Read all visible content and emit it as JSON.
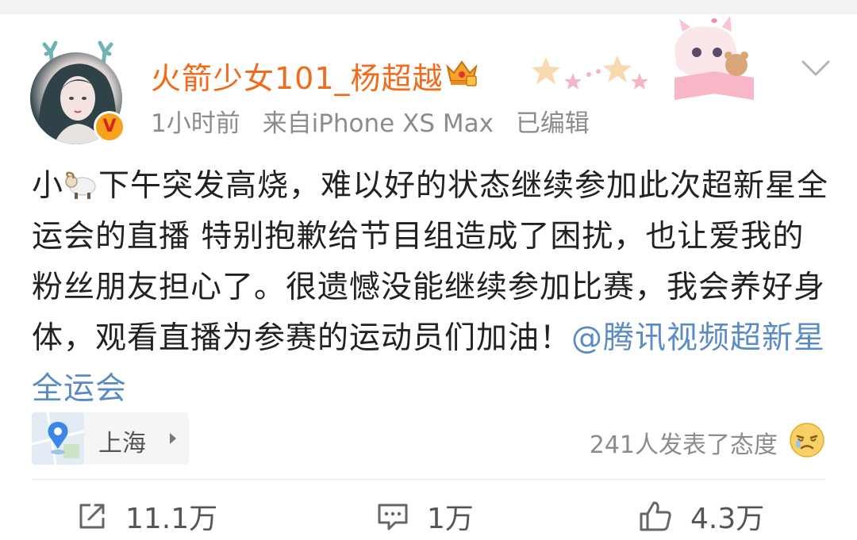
{
  "post": {
    "username": "火箭少女101_杨超越",
    "time": "1小时前",
    "source": "来自iPhone XS Max",
    "edited": "已编辑",
    "text_part1": "小",
    "text_part2": "下午突发高烧，难以好的状态继续参加此次超新星全运会的直播 特别抱歉给节目组造成了困扰，也让爱我的粉丝朋友担心了。很遗憾没能继续参加比赛，我会养好身体，观看直播为参赛的运动员们加油！",
    "mention": "@腾讯视频超新星全运会",
    "location": "上海",
    "reactions_text": "241人发表了态度"
  },
  "actions": {
    "repost": "11.1万",
    "comment": "1万",
    "like": "4.3万"
  },
  "icons": {
    "verified": "verified-v-badge-icon",
    "crown": "crown-icon",
    "more": "chevron-down-icon",
    "location": "location-pin-icon",
    "sheep": "sheep-emoji-icon",
    "reaction": "crying-face-icon",
    "repost": "repost-icon",
    "comment": "comment-icon",
    "like": "thumbs-up-icon"
  },
  "colors": {
    "username": "#f26a1b",
    "mention": "#5b8bc4",
    "meta": "#8c8c8c",
    "text": "#222222"
  }
}
